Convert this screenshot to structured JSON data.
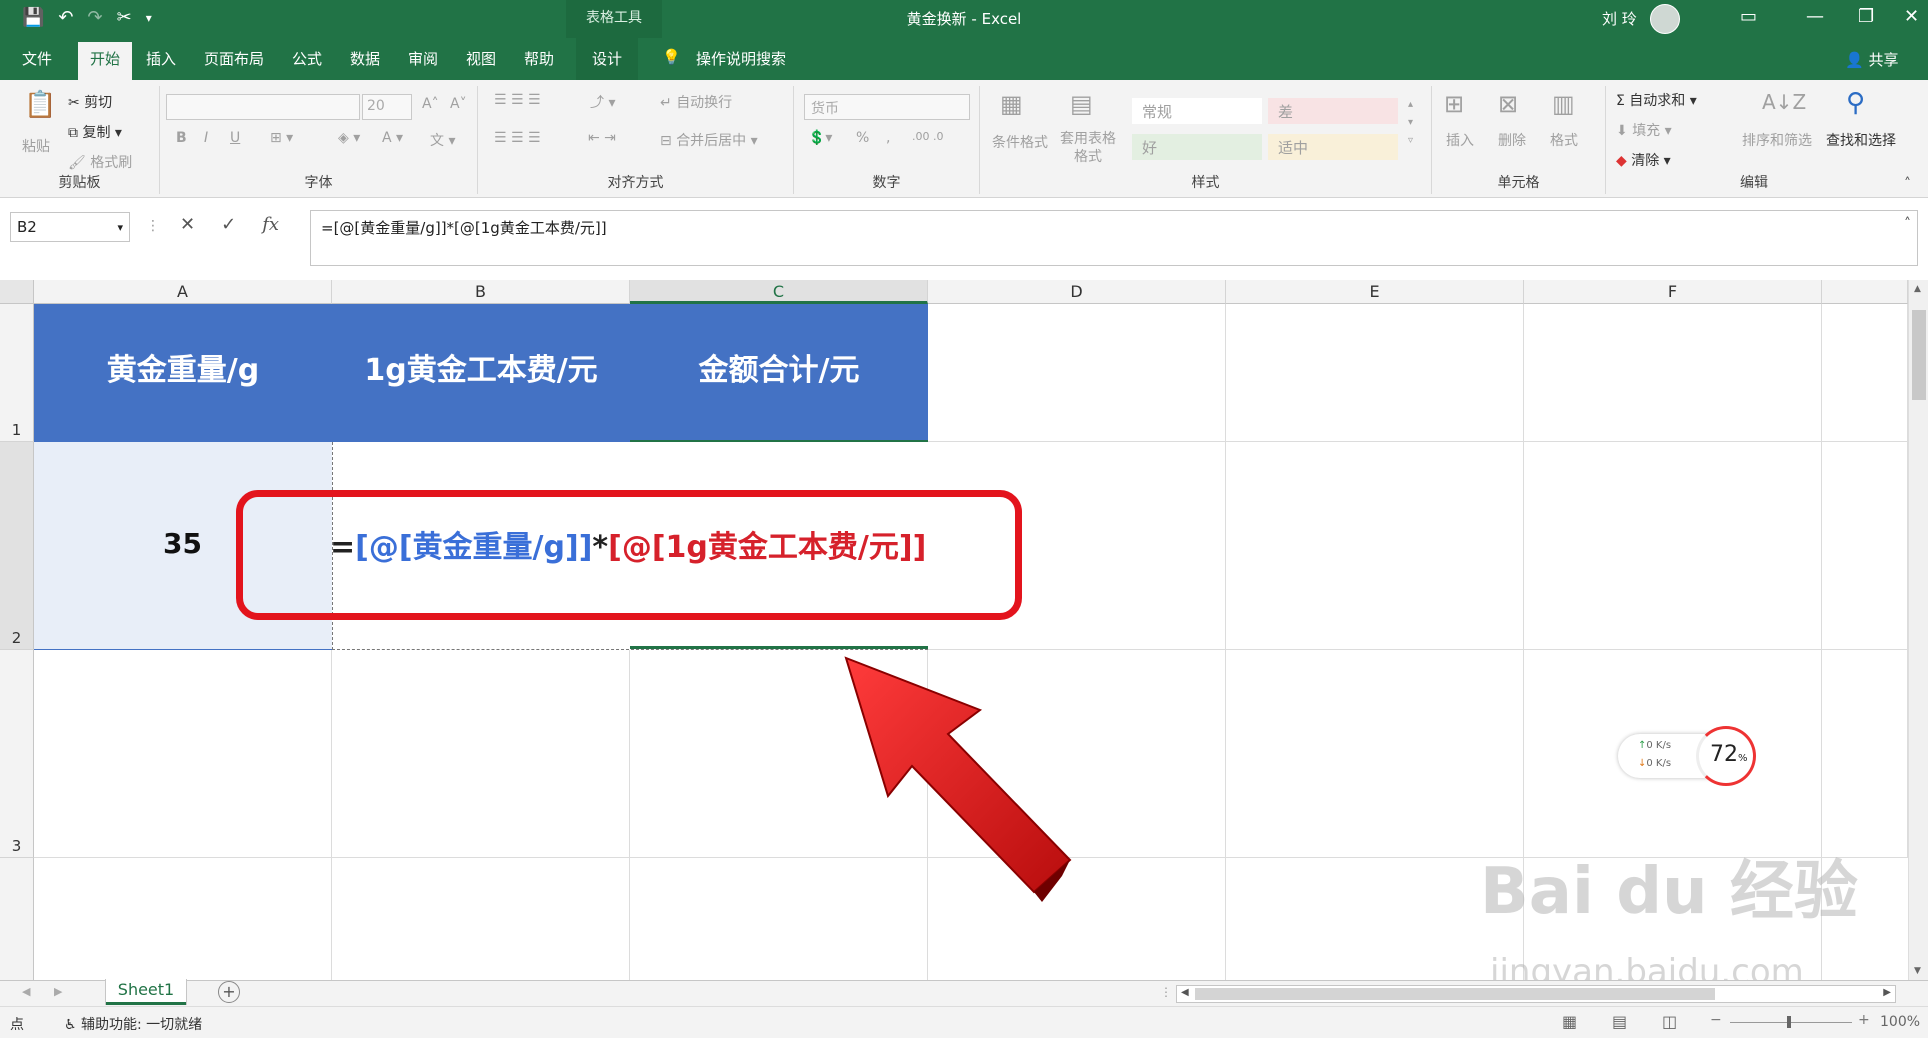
{
  "titlebar": {
    "context_tab": "表格工具",
    "title": "黄金换新  -  Excel",
    "user": "刘 玲",
    "icons": [
      "save-icon",
      "undo-icon",
      "redo-icon",
      "cut-icon",
      "customize-icon"
    ]
  },
  "menu": {
    "file": "文件",
    "home": "开始",
    "insert": "插入",
    "layout": "页面布局",
    "formulas": "公式",
    "data": "数据",
    "review": "审阅",
    "view": "视图",
    "help": "帮助",
    "design": "设计",
    "search": "操作说明搜索",
    "share": "共享"
  },
  "ribbon": {
    "clipboard": {
      "label": "剪贴板",
      "paste": "粘贴",
      "cut": "剪切",
      "copy": "复制",
      "format_painter": "格式刷"
    },
    "font": {
      "label": "字体",
      "size": "20",
      "bold": "B",
      "italic": "I",
      "underline": "U"
    },
    "alignment": {
      "label": "对齐方式",
      "wrap": "自动换行",
      "merge": "合并后居中"
    },
    "number": {
      "label": "数字",
      "format": "货币",
      "percent": "%",
      "comma": ","
    },
    "styles": {
      "label": "样式",
      "conditional": "条件格式",
      "table_format": "套用表格格式",
      "normal": "常规",
      "bad": "差",
      "good": "好",
      "neutral": "适中"
    },
    "cells": {
      "label": "单元格",
      "insert": "插入",
      "delete": "删除",
      "format": "格式"
    },
    "editing": {
      "label": "编辑",
      "autosum": "自动求和",
      "fill": "填充",
      "clear": "清除",
      "sort": "排序和筛选",
      "find": "查找和选择"
    }
  },
  "formula_bar": {
    "name_box": "B2",
    "cancel": "✕",
    "enter": "✓",
    "fx": "fx",
    "formula": "=[@[黄金重量/g]]*[@[1g黄金工本费/元]]"
  },
  "grid": {
    "columns": [
      "A",
      "B",
      "C",
      "D",
      "E",
      "F"
    ],
    "rows": [
      "1",
      "2",
      "3"
    ],
    "headers": [
      "黄金重量/g",
      "1g黄金工本费/元",
      "金额合计/元"
    ],
    "a2_value": "35",
    "formula_parts": {
      "eq": "=",
      "ref1": "[@[黄金重量/g]]",
      "op": "*",
      "ref2": "[@[1g黄金工本费/元]]"
    },
    "colors": {
      "header_fill": "#4472c4",
      "ref1": "#3a6fd8",
      "ref2": "#d6212b",
      "highlight": "#e3141d"
    }
  },
  "speed_widget": {
    "up": "0  K/s",
    "down": "0  K/s",
    "percent": "72",
    "unit": "%"
  },
  "sheets": {
    "tab": "Sheet1",
    "add": "+"
  },
  "status": {
    "mode": "点",
    "accessibility": "辅助功能: 一切就绪",
    "zoom": "100%"
  },
  "watermark": {
    "brand": "Bai  du 经验",
    "url": "jingyan.baidu.com"
  }
}
